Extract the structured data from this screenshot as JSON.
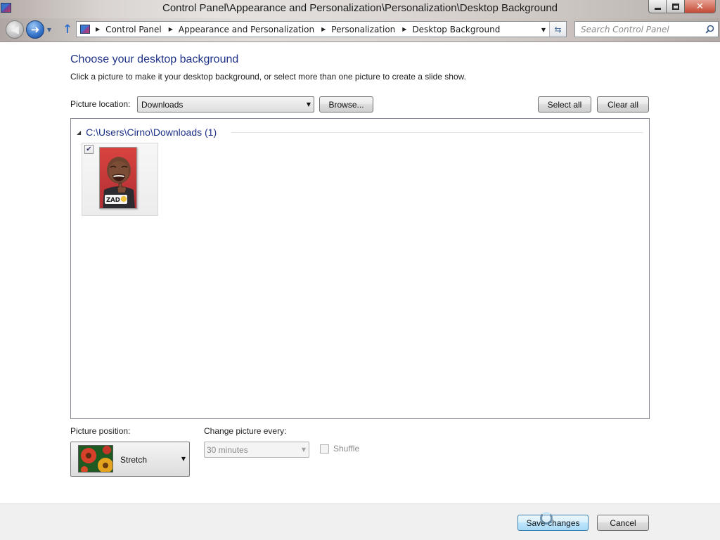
{
  "window": {
    "title": "Control Panel\\Appearance and Personalization\\Personalization\\Desktop Background"
  },
  "navigation": {
    "breadcrumbs": [
      {
        "label": "Control Panel"
      },
      {
        "label": "Appearance and Personalization"
      },
      {
        "label": "Personalization"
      },
      {
        "label": "Desktop Background"
      }
    ],
    "search_placeholder": "Search Control Panel"
  },
  "main": {
    "heading": "Choose your desktop background",
    "description": "Click a picture to make it your desktop background, or select more than one picture to create a slide show.",
    "picture_location": {
      "label": "Picture location:",
      "value": "Downloads",
      "browse_label": "Browse..."
    },
    "select_all_label": "Select all",
    "clear_all_label": "Clear all",
    "group": {
      "label": "C:\\Users\\Cirno\\Downloads (1)",
      "pictures": [
        {
          "checked": true,
          "caption_text": "ZAD"
        }
      ]
    },
    "picture_position": {
      "label": "Picture position:",
      "value": "Stretch"
    },
    "change_interval": {
      "label": "Change picture every:",
      "value": "30 minutes",
      "enabled": false
    },
    "shuffle": {
      "label": "Shuffle",
      "checked": false,
      "enabled": false
    }
  },
  "footer": {
    "save_label": "Save changes",
    "cancel_label": "Cancel"
  },
  "colors": {
    "heading": "#1e3287",
    "link_blue": "#1e3287",
    "disabled_text": "#8a8a8a",
    "primary_button_border": "#3c7fb1"
  }
}
